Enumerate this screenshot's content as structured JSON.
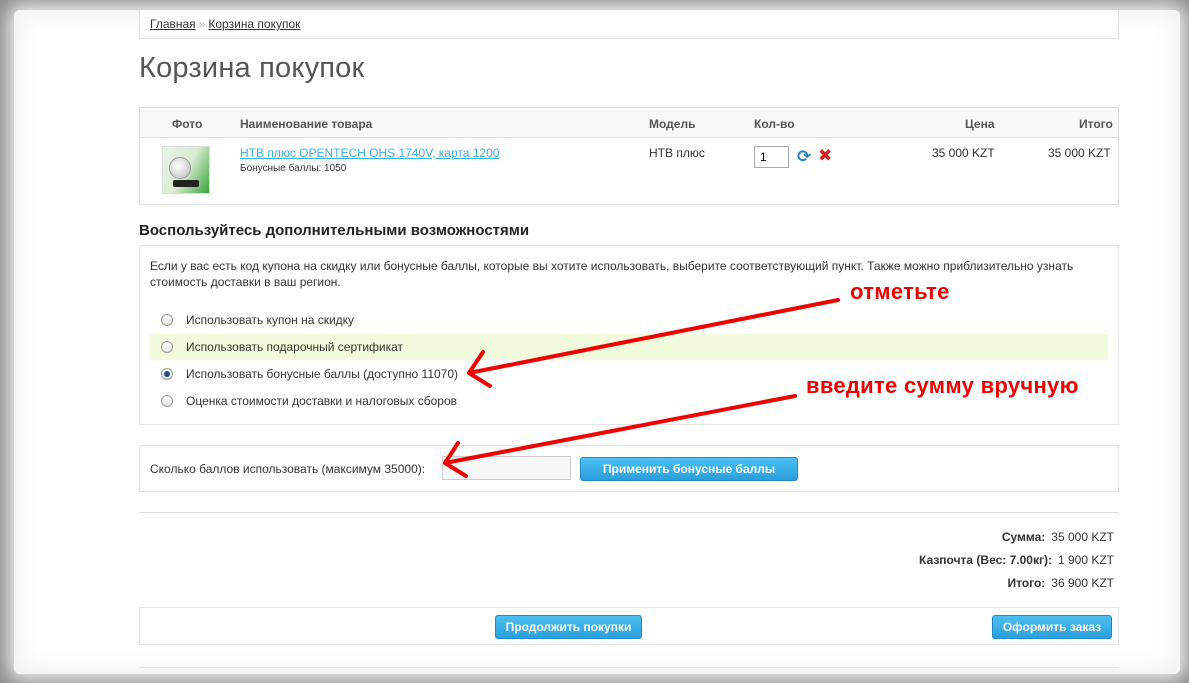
{
  "breadcrumb": {
    "home": "Главная",
    "separator": "»",
    "current": "Корзина покупок"
  },
  "page_title": "Корзина покупок",
  "cart": {
    "headers": {
      "photo": "Фото",
      "name": "Наименование товара",
      "model": "Модель",
      "qty": "Кол-во",
      "price": "Цена",
      "total": "Итого"
    },
    "items": [
      {
        "name": "НТВ плюс OPENTECH OHS 1740V, карта 1200",
        "bonus": "Бонусные баллы: 1050",
        "model": "НТВ плюс",
        "qty": "1",
        "price": "35 000 KZT",
        "total": "35 000 KZT",
        "icons": {
          "refresh": "refresh-icon",
          "remove": "remove-icon"
        }
      }
    ]
  },
  "options": {
    "heading": "Воспользуйтесь дополнительными возможностями",
    "intro": "Если у вас есть код купона на скидку или бонусные баллы, которые вы хотите использовать, выберите соответствующий пункт. Также можно приблизительно узнать стоимость доставки в ваш регион.",
    "items": [
      {
        "label": "Использовать купон на скидку",
        "checked": false
      },
      {
        "label": "Использовать подарочный сертификат",
        "checked": false
      },
      {
        "label": "Использовать бонусные баллы (доступно 11070)",
        "checked": true
      },
      {
        "label": "Оценка стоимости доставки и налоговых сборов",
        "checked": false
      }
    ]
  },
  "bonus": {
    "label": "Сколько баллов использовать (максимум 35000):",
    "value": "",
    "apply_button": "Применить бонусные баллы"
  },
  "totals": [
    {
      "label": "Сумма:",
      "value": "35 000 KZT"
    },
    {
      "label": "Казпочта (Вес: 7.00кг):",
      "value": "1 900 KZT"
    },
    {
      "label": "Итого:",
      "value": "36 900 KZT"
    }
  ],
  "buttons": {
    "continue": "Продолжить покупки",
    "checkout": "Оформить заказ"
  },
  "annotations": {
    "mark": "отметьте",
    "enter": "введите сумму вручную",
    "color": "#f20000"
  },
  "colors": {
    "link": "#38b0e3",
    "button": "#2a9fdc",
    "highlight_row": "#f2fbdc"
  }
}
